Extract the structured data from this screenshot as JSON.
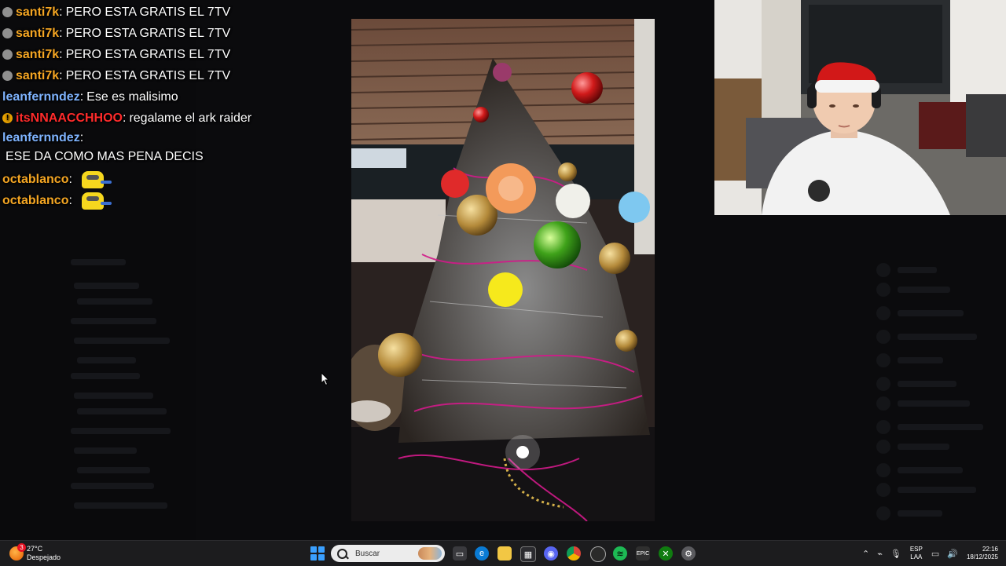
{
  "chat": {
    "messages": [
      {
        "user": "santi7k",
        "text": "PERO ESTA GRATIS EL 7TV",
        "color": "#f5a623",
        "badge": "gray"
      },
      {
        "user": "santi7k",
        "text": "PERO ESTA GRATIS EL 7TV",
        "color": "#f5a623",
        "badge": "gray"
      },
      {
        "user": "santi7k",
        "text": "PERO ESTA GRATIS EL 7TV",
        "color": "#f5a623",
        "badge": "gray"
      },
      {
        "user": "santi7k",
        "text": "PERO ESTA GRATIS EL 7TV",
        "color": "#f5a623",
        "badge": "gray"
      },
      {
        "user": "leanfernndez",
        "text": "Ese es malisimo",
        "color": "#7fb4ff",
        "badge": ""
      },
      {
        "user": "itsNNAACCHHOO",
        "text": "regalame el ark raider",
        "color": "#ff2b2b",
        "badge": "warn"
      },
      {
        "user": "leanfernndez",
        "text": "ESE DA COMO MAS PENA DECIS",
        "color": "#7fb4ff",
        "badge": ""
      },
      {
        "user": "octablanco",
        "text": "",
        "color": "#f5a623",
        "badge": "",
        "emote": "minion-emote"
      },
      {
        "user": "octablanco",
        "text": "",
        "color": "#f5a623",
        "badge": "",
        "emote": "minion-emote"
      }
    ]
  },
  "taskbar": {
    "weather_temp": "27°C",
    "weather_desc": "Despejado",
    "weather_badge": "3",
    "search_placeholder": "Buscar",
    "lang_top": "ESP",
    "lang_bottom": "LAA",
    "time": "22:16",
    "date": "18/12/2025",
    "apps": [
      "file-explorer-icon",
      "edge-icon",
      "folder-icon",
      "store-icon",
      "discord-icon",
      "chrome-icon",
      "obs-icon",
      "spotify-icon",
      "epic-games-icon",
      "xbox-icon",
      "settings-icon"
    ]
  },
  "colors": {
    "accent": "#3aa0ff",
    "chat_orange": "#f5a623",
    "chat_blue": "#7fb4ff",
    "chat_red": "#ff2b2b"
  }
}
